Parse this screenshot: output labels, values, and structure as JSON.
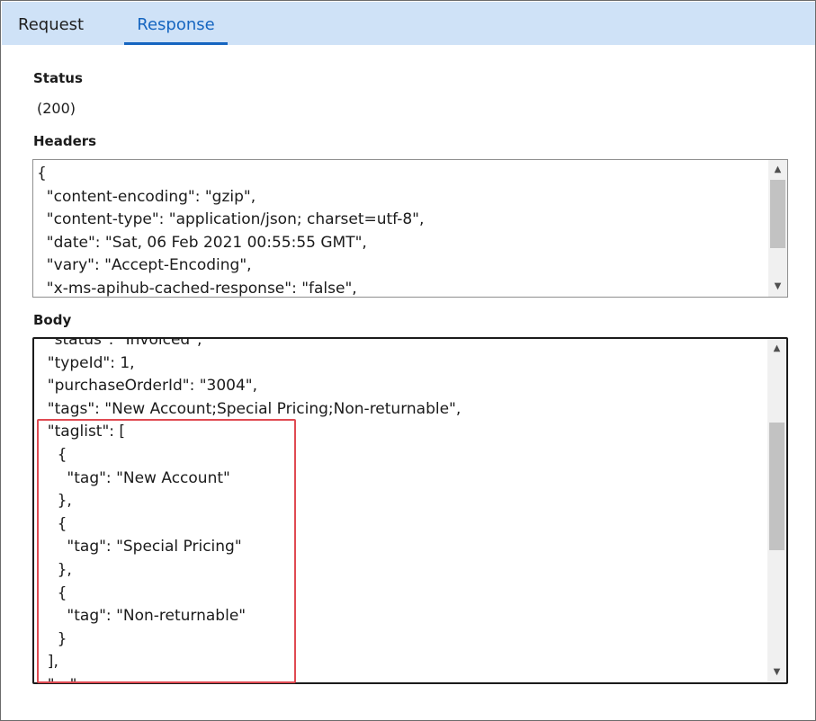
{
  "tabs": [
    {
      "label": "Request",
      "active": false
    },
    {
      "label": "Response",
      "active": true
    }
  ],
  "accent_color": "#1565c0",
  "tabbar_color": "#cfe2f7",
  "highlight_color": "#e04a52",
  "status": {
    "label": "Status",
    "value": "(200)"
  },
  "headers": {
    "label": "Headers",
    "lines": [
      "{",
      "  \"content-encoding\": \"gzip\",",
      "  \"content-type\": \"application/json; charset=utf-8\",",
      "  \"date\": \"Sat, 06 Feb 2021 00:55:55 GMT\",",
      "  \"vary\": \"Accept-Encoding\",",
      "  \"x-ms-apihub-cached-response\": \"false\","
    ]
  },
  "body": {
    "label": "Body",
    "lines": [
      "  \"status\": \"Invoiced\",",
      "  \"typeId\": 1,",
      "  \"purchaseOrderId\": \"3004\",",
      "  \"tags\": \"New Account;Special Pricing;Non-returnable\",",
      "  \"taglist\": [",
      "    {",
      "      \"tag\": \"New Account\"",
      "    },",
      "    {",
      "      \"tag\": \"Special Pricing\"",
      "    },",
      "    {",
      "      \"tag\": \"Non-returnable\"",
      "    }",
      "  ],",
      "  \"…\""
    ]
  }
}
